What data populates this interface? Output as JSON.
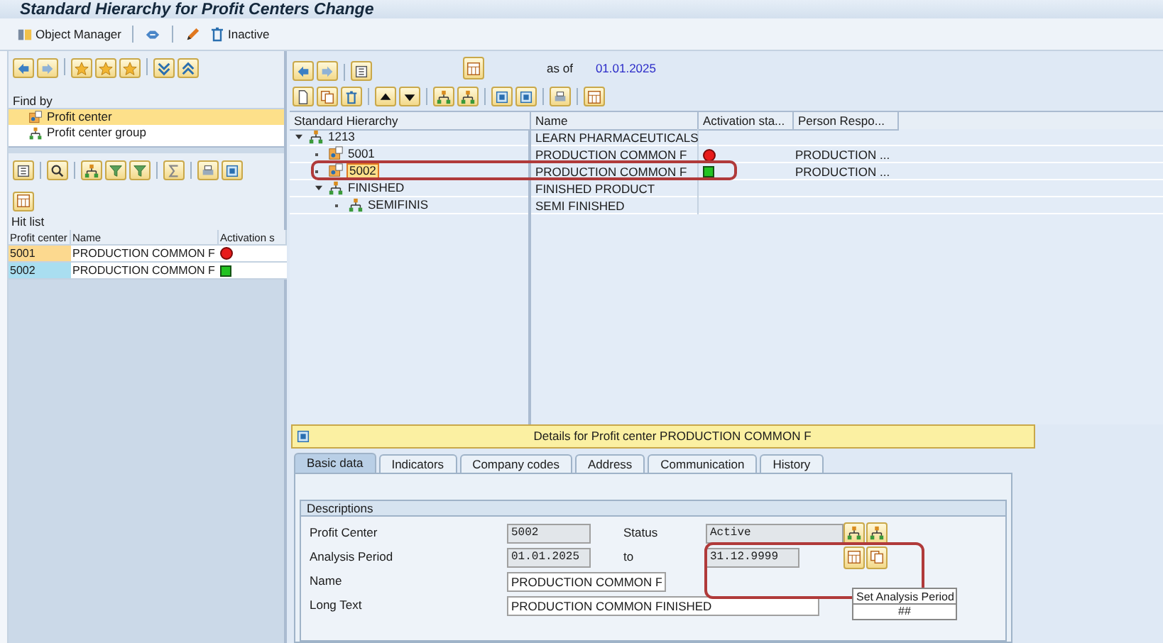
{
  "window": {
    "title": "Standard Hierarchy for Profit Centers Change"
  },
  "toolbar": {
    "object_manager": "Object Manager",
    "inactive": "Inactive"
  },
  "find_by": {
    "title": "Find by",
    "items": [
      {
        "label": "Profit center",
        "kind": "center",
        "selected": true
      },
      {
        "label": "Profit center group",
        "kind": "group",
        "selected": false
      }
    ]
  },
  "hit_list": {
    "title": "Hit list",
    "columns": [
      "Profit center",
      "Name",
      "Activation s"
    ],
    "rows": [
      {
        "id": "5001",
        "name": "PRODUCTION COMMON F",
        "active": false,
        "color": "#fcd98f"
      },
      {
        "id": "5002",
        "name": "PRODUCTION COMMON F",
        "active": true,
        "color": "#a9def0"
      }
    ]
  },
  "hierarchy": {
    "as_of_label": "as of",
    "as_of_date": "01.01.2025",
    "columns": [
      "Standard Hierarchy",
      "Name",
      "Activation sta...",
      "Person Respo..."
    ],
    "nodes": [
      {
        "id": "1213",
        "kind": "group",
        "name": "LEARN PHARMACEUTICALS",
        "expanded": true,
        "selected": false,
        "children": [
          {
            "id": "5001",
            "kind": "center",
            "name": "PRODUCTION COMMON F",
            "active": false,
            "person": "PRODUCTION ...",
            "selected": false
          },
          {
            "id": "5002",
            "kind": "center",
            "name": "PRODUCTION COMMON F",
            "active": true,
            "person": "PRODUCTION ...",
            "selected": true
          },
          {
            "id": "FINISHED",
            "kind": "group",
            "name": "FINISHED PRODUCT",
            "expanded": true,
            "selected": false,
            "children": [
              {
                "id": "SEMIFINIS",
                "kind": "group",
                "name": "SEMI FINISHED",
                "selected": false
              }
            ]
          }
        ]
      }
    ]
  },
  "details": {
    "title": "Details for Profit center PRODUCTION COMMON F",
    "tabs": [
      {
        "label": "Basic data",
        "selected": true
      },
      {
        "label": "Indicators",
        "selected": false
      },
      {
        "label": "Company codes",
        "selected": false
      },
      {
        "label": "Address",
        "selected": false
      },
      {
        "label": "Communication",
        "selected": false
      },
      {
        "label": "History",
        "selected": false
      }
    ],
    "group_title": "Descriptions",
    "profit_center_label": "Profit Center",
    "profit_center": "5002",
    "status_label": "Status",
    "status": "Active",
    "period_label": "Analysis Period",
    "period_from": "01.01.2025",
    "to_label": "to",
    "period_to": "31.12.9999",
    "name_label": "Name",
    "name": "PRODUCTION COMMON F",
    "long_text_label": "Long Text",
    "long_text": "PRODUCTION COMMON FINISHED"
  },
  "tooltip": {
    "text": "Set Analysis Period",
    "shortcut": "##"
  }
}
